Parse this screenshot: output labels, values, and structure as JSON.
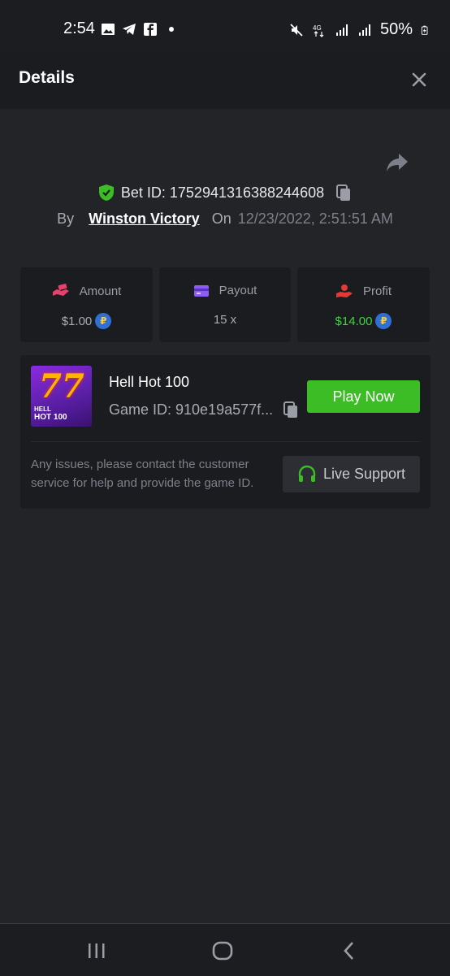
{
  "status_bar": {
    "time": "2:54",
    "battery": "50%",
    "left_icons": [
      "image-icon",
      "telegram-icon",
      "facebook-icon",
      "dot-icon"
    ],
    "right_icons": [
      "mute-icon",
      "4g-icon",
      "signal-icon",
      "signal-icon"
    ]
  },
  "header": {
    "title": "Details",
    "close_icon": "close-icon"
  },
  "bet": {
    "bet_id_label": "Bet ID: 1752941316388244608",
    "by_label": "By",
    "user": "Winston Victory",
    "on_label": "On",
    "date": "12/23/2022, 2:51:51 AM"
  },
  "stats": {
    "amount": {
      "label": "Amount",
      "value": "$1.00",
      "icon": "money-hand-icon",
      "color": "#e7406a"
    },
    "payout": {
      "label": "Payout",
      "value": "15 x",
      "icon": "card-icon",
      "color": "#8b5cf6"
    },
    "profit": {
      "label": "Profit",
      "value": "$14.00",
      "icon": "profit-hand-icon",
      "color": "#e53935"
    }
  },
  "game": {
    "name": "Hell Hot 100",
    "game_id": "Game ID: 910e19a577f...",
    "thumb_text_top": "HELL",
    "thumb_text_bottom": "HOT 100",
    "thumb_sevens": "77",
    "play_label": "Play Now",
    "support_text": "Any issues, please contact the customer service for help and provide the game ID.",
    "support_label": "Live Support"
  },
  "colors": {
    "accent_green": "#3dbd25",
    "profit_green": "#3fd33f",
    "background": "#232428",
    "panel": "#1b1c1f"
  }
}
